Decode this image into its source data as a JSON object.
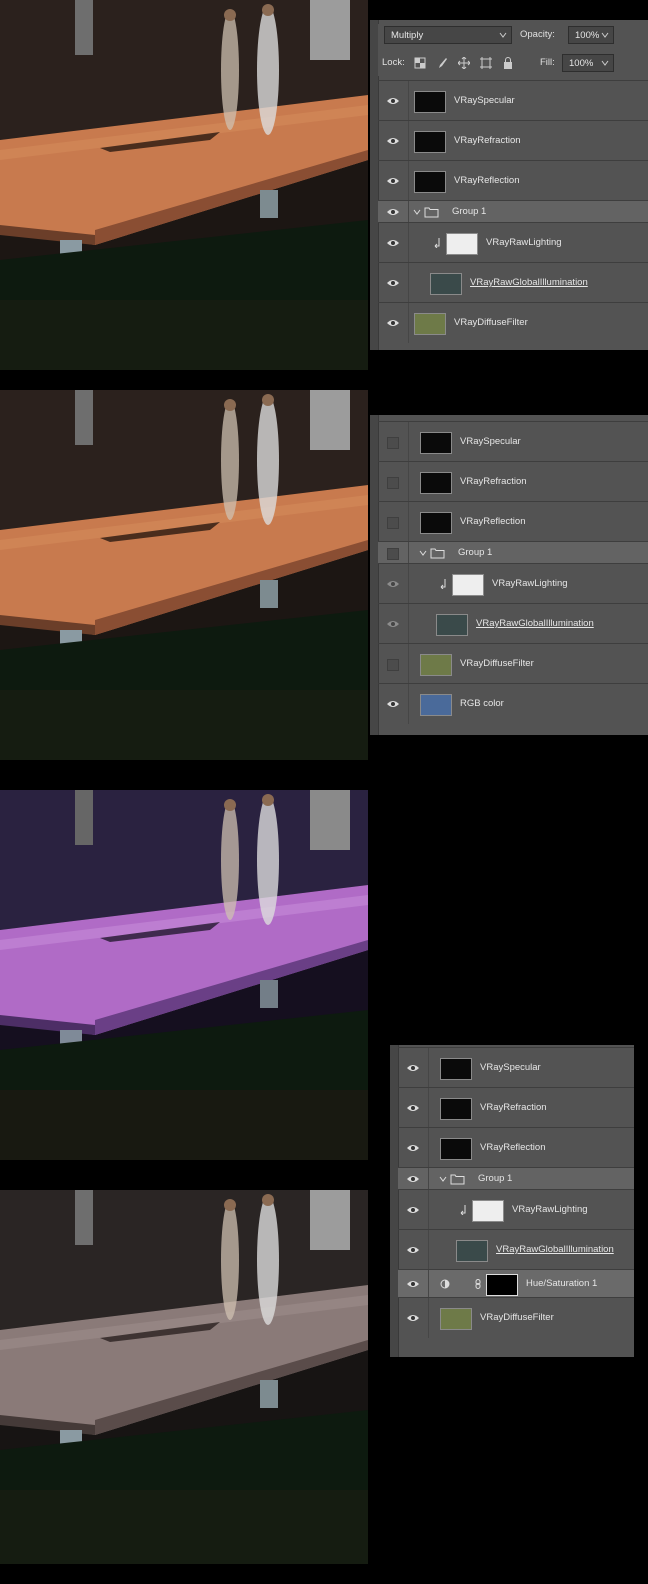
{
  "colors": {
    "panel_bg": "#535353",
    "group_row_bg": "#636363",
    "selected_row_bg": "#6a6a6a",
    "text": "#e6e6e6",
    "wood_orange": "#c9764a",
    "wood_purple": "#b06bc6",
    "wood_gray": "#8a7a78"
  },
  "renders": [
    {
      "name": "multiply-composite",
      "tint": "orange"
    },
    {
      "name": "rgb-color-composite",
      "tint": "orange"
    },
    {
      "name": "purple-diffuse-composite",
      "tint": "purple"
    },
    {
      "name": "hue-saturation-composite",
      "tint": "gray"
    }
  ],
  "panel1": {
    "blend_mode": "Multiply",
    "opacity_label": "Opacity:",
    "opacity_value": "100%",
    "lock_label": "Lock:",
    "fill_label": "Fill:",
    "fill_value": "100%",
    "layers": [
      {
        "name": "VRaySpecular",
        "visible": true,
        "icon": "eye-icon"
      },
      {
        "name": "VRayRefraction",
        "visible": true,
        "icon": "eye-icon"
      },
      {
        "name": "VRayReflection",
        "visible": true,
        "icon": "eye-icon"
      },
      {
        "name": "Group 1",
        "visible": true,
        "icon": "eye-icon",
        "type": "group"
      },
      {
        "name": "VRayRawLighting",
        "visible": true,
        "icon": "eye-icon",
        "clipped": true
      },
      {
        "name": "VRayRawGlobalIllumination",
        "visible": true,
        "icon": "eye-icon"
      },
      {
        "name": "VRayDiffuseFilter",
        "visible": true,
        "icon": "eye-icon"
      }
    ]
  },
  "panel2": {
    "layers": [
      {
        "name": "VRaySpecular",
        "visible": false
      },
      {
        "name": "VRayRefraction",
        "visible": false
      },
      {
        "name": "VRayReflection",
        "visible": false
      },
      {
        "name": "Group 1",
        "visible": false,
        "type": "group"
      },
      {
        "name": "VRayRawLighting",
        "visible": true,
        "clipped": true
      },
      {
        "name": "VRayRawGlobalIllumination",
        "visible": true
      },
      {
        "name": "VRayDiffuseFilter",
        "visible": false
      },
      {
        "name": "RGB color",
        "visible": true
      }
    ]
  },
  "panel3": {
    "layers": [
      {
        "name": "VRaySpecular",
        "visible": true
      },
      {
        "name": "VRayRefraction",
        "visible": true
      },
      {
        "name": "VRayReflection",
        "visible": true
      },
      {
        "name": "Group 1",
        "visible": true,
        "type": "group"
      },
      {
        "name": "VRayRawLighting",
        "visible": true,
        "clipped": true
      },
      {
        "name": "VRayRawGlobalIllumination",
        "visible": true
      },
      {
        "name": "Hue/Saturation 1",
        "visible": true,
        "type": "adjustment"
      },
      {
        "name": "VRayDiffuseFilter",
        "visible": true
      }
    ]
  }
}
